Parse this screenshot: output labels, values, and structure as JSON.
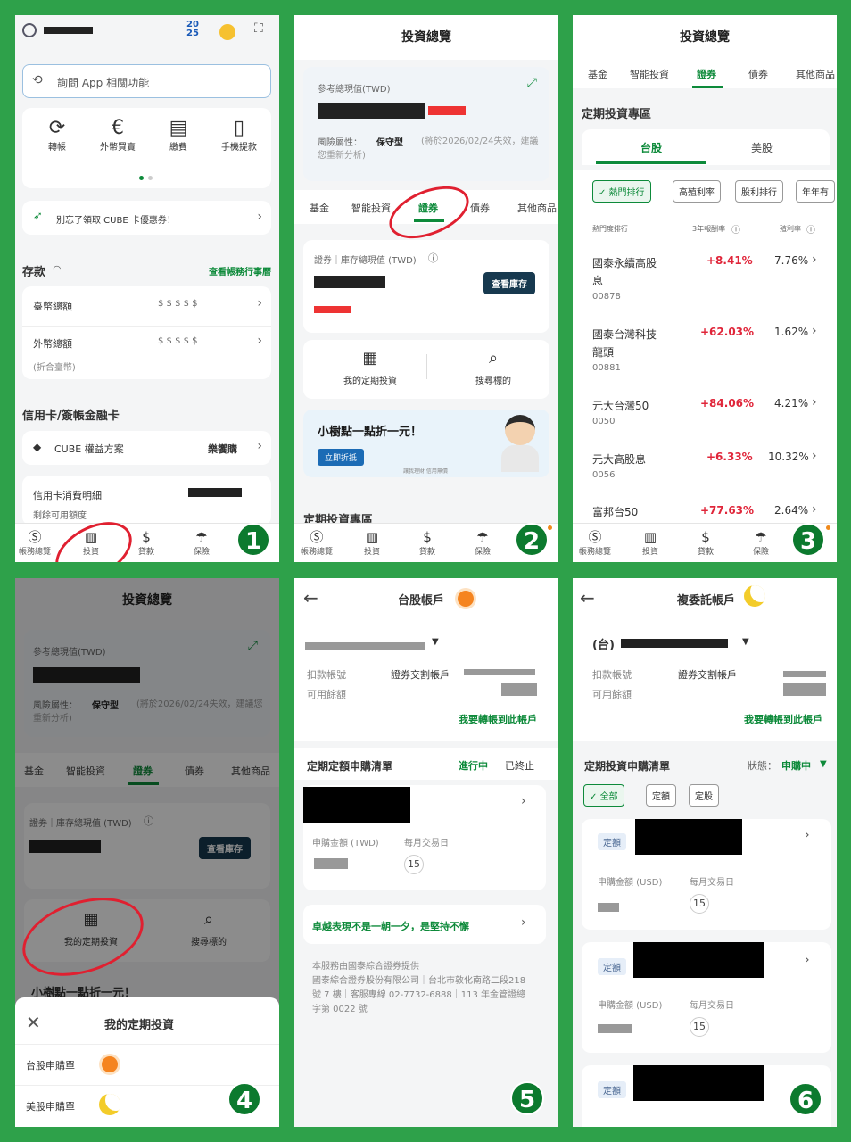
{
  "colors": {
    "accent": "#0d8a3a",
    "frame": "#2ea14a",
    "up": "#e0263a",
    "dark_button": "#17394f"
  },
  "icons": [
    "user-icon",
    "calendar-icon",
    "coin-icon",
    "expand-icon",
    "search-icon",
    "transfer-icon",
    "exchange-icon",
    "bill-icon",
    "phone-icon",
    "rocket-icon",
    "eye-icon",
    "dollar-icon",
    "chevron-right-icon",
    "shield-icon",
    "wallet-icon",
    "chart-icon",
    "umbrella-icon",
    "back-arrow-icon",
    "sun-icon",
    "moon-icon",
    "close-icon",
    "check-icon",
    "info-icon",
    "dropdown-icon"
  ],
  "p1": {
    "date_top": "20",
    "date_bottom": "25",
    "search_placeholder": "詢問 App 相關功能",
    "quick": [
      "轉帳",
      "外幣買賣",
      "繳費",
      "手機提款"
    ],
    "banner": "別忘了領取 CUBE 卡優惠券！",
    "deposit_title": "存款",
    "deposit_link": "查看帳務行事曆",
    "twd_total": "臺幣總額",
    "fx_total": "外幣總額",
    "fx_sub": "(折合臺幣)",
    "masked": "$ $ $ $ $",
    "card_title": "信用卡/簽帳金融卡",
    "cube_plan": "CUBE 權益方案",
    "cube_value": "樂饗購",
    "detail": "信用卡消費明細",
    "detail_sub": "剩餘可用額度",
    "nav": [
      "帳務總覽",
      "投資",
      "貸款",
      "保險",
      "更多"
    ],
    "step": "1"
  },
  "p2": {
    "title": "投資總覽",
    "ref_label": "參考總現值(TWD)",
    "risk": "風險屬性：",
    "risk_value": "保守型",
    "risk_note": "(將於2026/02/24失效，建議您重新分析)",
    "tabs": [
      "基金",
      "智能投資",
      "證券",
      "債券",
      "其他商品"
    ],
    "sec_label": "證券｜庫存總現值 (TWD)",
    "inventory_btn": "查看庫存",
    "my_plan": "我的定期投資",
    "search_target": "搜尋標的",
    "promo": "小樹點一點折一元！",
    "promo_btn": "立即折抵",
    "promo_small": "讓我理財 信用無價",
    "section": "定期投資專區",
    "nav": [
      "帳務總覽",
      "投資",
      "貸款",
      "保險",
      "更多"
    ],
    "step": "2"
  },
  "p3": {
    "title": "投資總覽",
    "tabs": [
      "基金",
      "智能投資",
      "證券",
      "債券",
      "其他商品"
    ],
    "section": "定期投資專區",
    "market_tabs": [
      "台股",
      "美股"
    ],
    "filters": [
      "熱門排行",
      "高殖利率",
      "股利排行",
      "年年有"
    ],
    "cols": [
      "熱門度排行",
      "3年報酬率",
      "殖利率"
    ],
    "rows": [
      {
        "name": "國泰永續高股息",
        "code": "00878",
        "ret": "+8.41%",
        "yield": "7.76%"
      },
      {
        "name": "國泰台灣科技龍頭",
        "code": "00881",
        "ret": "+62.03%",
        "yield": "1.62%"
      },
      {
        "name": "元大台灣50",
        "code": "0050",
        "ret": "+84.06%",
        "yield": "4.21%"
      },
      {
        "name": "元大高股息",
        "code": "0056",
        "ret": "+6.33%",
        "yield": "10.32%"
      },
      {
        "name": "富邦台50",
        "code": "",
        "ret": "+77.63%",
        "yield": "2.64%"
      }
    ],
    "nav": [
      "帳務總覽",
      "投資",
      "貸款",
      "保險",
      "更多"
    ],
    "step": "3"
  },
  "p4": {
    "title": "投資總覽",
    "ref_label": "參考總現值(TWD)",
    "risk": "風險屬性：",
    "risk_value": "保守型",
    "risk_note": "(將於2026/02/24失效，建議您重新分析)",
    "tabs": [
      "基金",
      "智能投資",
      "證券",
      "債券",
      "其他商品"
    ],
    "sec_label": "證券｜庫存總現值 (TWD)",
    "inventory_btn": "查看庫存",
    "my_plan": "我的定期投資",
    "search_target": "搜尋標的",
    "promo": "小樹點一點折一元！",
    "sheet_title": "我的定期投資",
    "tw_order": "台股申購單",
    "us_order": "美股申購單",
    "step": "4"
  },
  "p5": {
    "title": "台股帳戶",
    "debit": "扣款帳號",
    "available": "可用餘額",
    "settle": "證券交割帳戶",
    "transfer": "我要轉帳到此帳戶",
    "list_title": "定期定額申購清單",
    "active": "進行中",
    "ended": "已終止",
    "amount_label": "申購金額 (TWD)",
    "day_label": "每月交易日",
    "day": "15",
    "slogan": "卓越表現不是一朝一夕，是堅持不懈",
    "footer": "本服務由國泰綜合證券提供\n國泰綜合證券股份有限公司｜台北市敦化南路二段218 號 7 樓｜客服專線 02-7732-6888｜113 年金管證總字第 0022 號",
    "step": "5"
  },
  "p6": {
    "title": "複委託帳戶",
    "account_prefix": "(台)",
    "debit": "扣款帳號",
    "available": "可用餘額",
    "settle": "證券交割帳戶",
    "transfer": "我要轉帳到此帳戶",
    "list_title": "定期投資申購清單",
    "status_label": "狀態：",
    "status_value": "申購中",
    "filters": [
      "全部",
      "定額",
      "定股"
    ],
    "tag": "定額",
    "amount_label": "申購金額 (USD)",
    "day_label": "每月交易日",
    "day": "15",
    "step": "6"
  }
}
